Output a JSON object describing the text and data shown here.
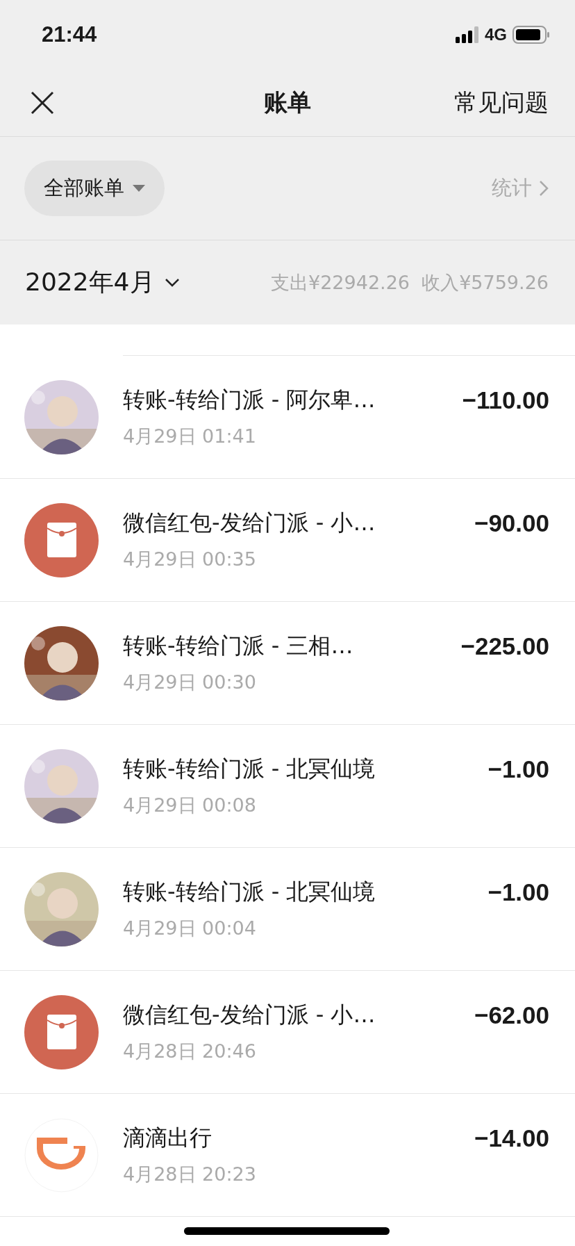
{
  "status_bar": {
    "time": "21:44",
    "network": "4G"
  },
  "nav": {
    "title": "账单",
    "action": "常见问题"
  },
  "filter": {
    "label": "全部账单",
    "stats": "统计"
  },
  "month": {
    "label": "2022年4月",
    "summary": "支出¥22942.26  收入¥5759.26"
  },
  "transactions": [
    {
      "title": "转账-转给门派 - 阿尔卑…",
      "date": "4月29日 01:41",
      "amount": "−110.00"
    },
    {
      "kind": "red_packet",
      "title": "微信红包-发给门派 - 小…",
      "date": "4月29日 00:35",
      "amount": "−90.00"
    },
    {
      "title": "转账-转给门派 - 三相…",
      "date": "4月29日 00:30",
      "amount": "−225.00"
    },
    {
      "title": "转账-转给门派 - 北冥仙境",
      "date": "4月29日 00:08",
      "amount": "−1.00"
    },
    {
      "title": "转账-转给门派 - 北冥仙境",
      "date": "4月29日 00:04",
      "amount": "−1.00"
    },
    {
      "kind": "red_packet",
      "title": "微信红包-发给门派 - 小…",
      "date": "4月28日 20:46",
      "amount": "−62.00"
    },
    {
      "kind": "didi",
      "title": "滴滴出行",
      "date": "4月28日 20:23",
      "amount": "−14.00"
    }
  ]
}
